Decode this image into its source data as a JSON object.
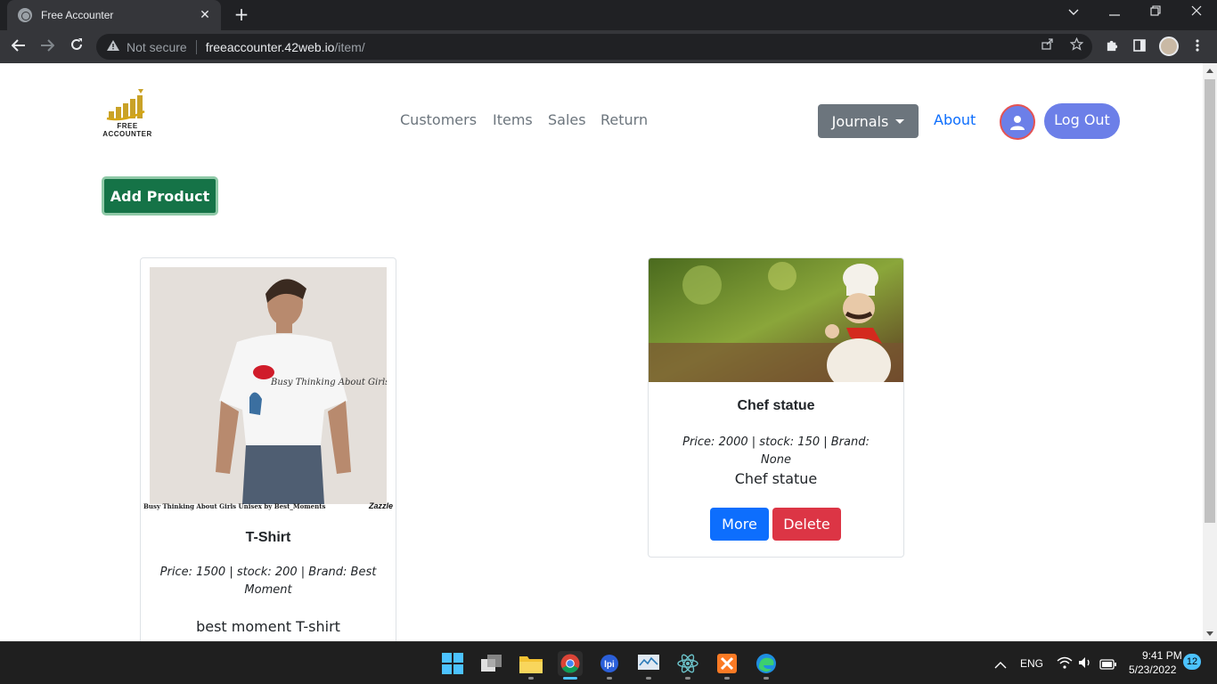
{
  "browser": {
    "tab_title": "Free Accounter",
    "tab_close": "✕",
    "new_tab": "+",
    "security_label": "Not secure",
    "url_host": "freeaccounter.42web.io",
    "url_path": "/item/"
  },
  "header": {
    "logo_text_line1": "FREE",
    "logo_text_line2": "ACCOUNTER",
    "nav": [
      "Customers",
      "Items",
      "Sales",
      "Return"
    ],
    "journals_label": "Journals",
    "about_label": "About",
    "logout_label": "Log Out"
  },
  "actions": {
    "add_product_label": "Add Product"
  },
  "products": [
    {
      "name": "T-Shirt",
      "meta_line1": "Price: 1500 | stock: 200 | Brand: Best",
      "meta_line2": "Moment",
      "description": "best moment T-shirt",
      "image_caption": "Busy Thinking About Girls Unisex by Best_Moments",
      "image_brand": "Zazzle",
      "shirt_print": "Busy Thinking About Girls"
    },
    {
      "name": "Chef statue",
      "meta_line1": "Price: 2000 | stock: 150 | Brand: None",
      "description": "Chef statue",
      "more_label": "More",
      "delete_label": "Delete"
    }
  ],
  "taskbar": {
    "language": "ENG",
    "time": "9:41 PM",
    "date": "5/23/2022",
    "notifications": "12"
  },
  "colors": {
    "primary": "#0d6efd",
    "danger": "#dc3545",
    "success": "#157347",
    "secondary": "#6c757d",
    "accent_pill": "#6c7fe8"
  }
}
